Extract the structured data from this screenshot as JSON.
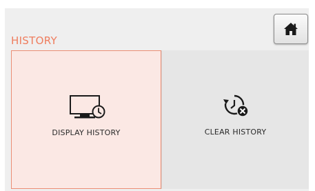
{
  "header": {
    "section_title": "HISTORY",
    "home_button_icon": "home-icon"
  },
  "tiles": [
    {
      "label": "DISPLAY HISTORY",
      "icon": "display-history-icon",
      "selected": true
    },
    {
      "label": "CLEAR HISTORY",
      "icon": "clear-history-icon",
      "selected": false
    }
  ],
  "colors": {
    "accent": "#ef7d5e",
    "selected_tile_background": "#fbe8e4",
    "selected_tile_border": "#ec8d73",
    "tile_background": "#e6e6e6",
    "panel_background": "#efefef"
  }
}
